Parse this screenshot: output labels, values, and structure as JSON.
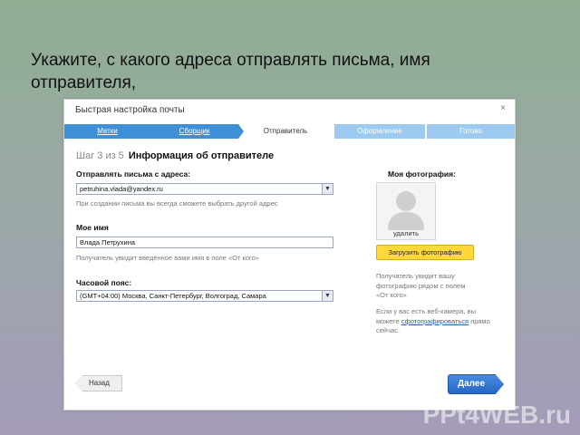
{
  "slide": {
    "title": "Укажите, с какого адреса отправлять письма, имя отправителя,",
    "watermark": "PPt4WEB.ru"
  },
  "dialog": {
    "title": "Быстрая настройка почты",
    "close": "×",
    "steps": [
      {
        "label": "Метки",
        "state": "done"
      },
      {
        "label": "Сборщик",
        "state": "done"
      },
      {
        "label": "Отправитель",
        "state": "active"
      },
      {
        "label": "Оформление",
        "state": "future"
      },
      {
        "label": "Готово",
        "state": "future"
      }
    ],
    "step_number": "Шаг 3 из 5",
    "step_title": "Информация об отправителе",
    "from": {
      "label": "Отправлять письма с адреса:",
      "value": "petruhina.vlada@yandex.ru",
      "hint": "При создании письма вы всегда сможете выбрать другой адрес"
    },
    "name": {
      "label": "Мое имя",
      "value": "Влада Петрухина",
      "hint": "Получатель увидит введённое вами имя в поле «От кого»"
    },
    "timezone": {
      "label": "Часовой пояс:",
      "value": "(GMT+04:00) Москва, Санкт-Петербург, Волгоград, Самара"
    },
    "photo": {
      "label": "Моя фотография:",
      "delete": "удалить",
      "upload": "Загрузить фотографию",
      "info1_l1": "Получатель увидит вашу",
      "info1_l2": "фотографию рядом с полем",
      "info1_l3": "«От кого»",
      "info2_l1": "Если у вас есть веб-камера, вы",
      "info2_pre": "можете",
      "info2_link": "сфотографироваться",
      "info2_post": "прямо",
      "info2_l3": "сейчас."
    },
    "back": "Назад",
    "next": "Далее"
  },
  "colors": {
    "step_done": "#3d8fd8",
    "step_future": "#9ccaf0",
    "upload_button": "#ffd93a",
    "next_button": "#2667c4"
  }
}
